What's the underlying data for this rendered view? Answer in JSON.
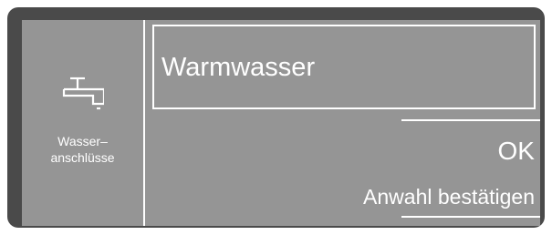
{
  "sidebar": {
    "icon": "water-tap-icon",
    "label_line1": "Wasser–",
    "label_line2": "anschlüsse"
  },
  "selection": {
    "value": "Warmwasser"
  },
  "confirm": {
    "ok_label": "OK",
    "hint": "Anwahl bestätigen"
  },
  "colors": {
    "bezel": "#4a4a4a",
    "screen": "#959595",
    "foreground": "#ffffff"
  }
}
